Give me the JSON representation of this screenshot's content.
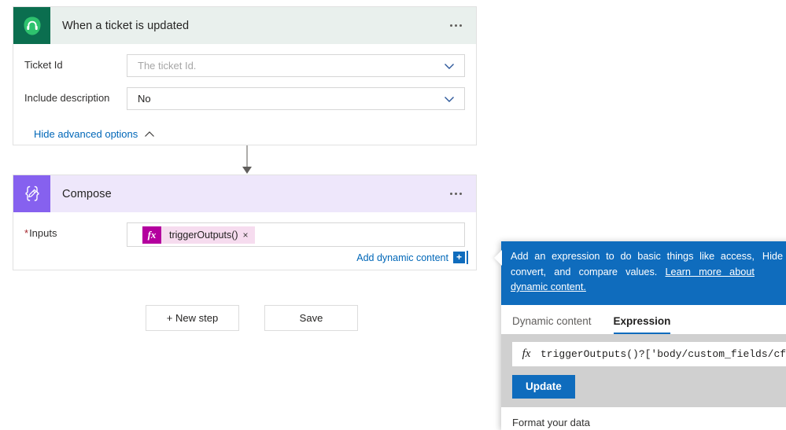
{
  "trigger_card": {
    "icon": "headset-icon",
    "title": "When a ticket is updated",
    "menu": "...",
    "fields": [
      {
        "label": "Ticket Id",
        "value": "",
        "placeholder": "The ticket Id.",
        "chevron": "chevron-down-icon"
      },
      {
        "label": "Include description",
        "value": "No",
        "placeholder": "",
        "chevron": "chevron-down-icon"
      }
    ],
    "advanced_link": "Hide advanced options"
  },
  "compose_card": {
    "icon": "compose-braces-icon",
    "title": "Compose",
    "menu": "...",
    "inputs_label": "Inputs",
    "required_marker": "*",
    "token": {
      "fx": "fx",
      "label": "triggerOutputs()",
      "remove": "×"
    },
    "add_dynamic_content": "Add dynamic content",
    "add_dynamic_plus": "+"
  },
  "designer_buttons": {
    "new_step": "+ New step",
    "save": "Save"
  },
  "expression_panel": {
    "banner": {
      "text_before_link": "Add an expression to do basic things like access, convert, and compare values. ",
      "link_text": "Learn more about dynamic content.",
      "hide_label": "Hide"
    },
    "tabs": [
      {
        "label": "Dynamic content",
        "active": false
      },
      {
        "label": "Expression",
        "active": true
      }
    ],
    "expression_input": {
      "fx_glyph": "fx",
      "value": "triggerOutputs()?['body/custom_fields/cf_"
    },
    "update_button": "Update",
    "footer_heading": "Format your data"
  },
  "colors": {
    "trigger_icon_bg": "#0b6e4f",
    "trigger_icon_fg": "#2ec26e",
    "trigger_header_bg": "#e9f0ed",
    "compose_icon_bg": "#8661ef",
    "compose_header_bg": "#eee7fb",
    "accent_blue": "#0f6cbd",
    "link_blue": "#0067b8",
    "token_bg": "#f6dcef",
    "token_fx_bg": "#b4009e",
    "required_red": "#a4262c"
  }
}
